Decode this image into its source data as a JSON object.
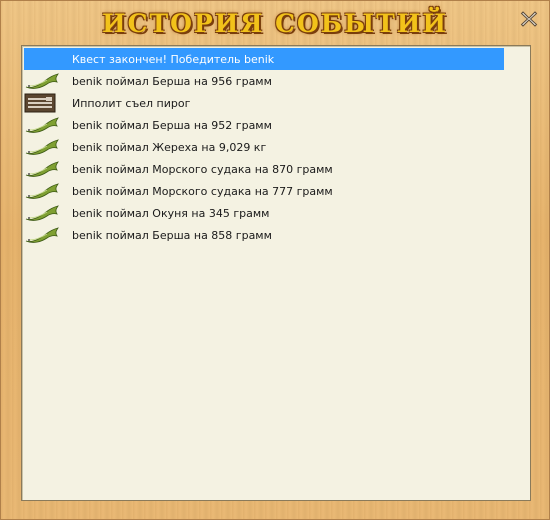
{
  "window": {
    "title": "ИСТОРИЯ СОБЫТИЙ",
    "close_icon": "close-x-icon"
  },
  "events": [
    {
      "icon": "none",
      "text": "Квест закончен! Победитель benik",
      "selected": true
    },
    {
      "icon": "fish-icon",
      "text": "benik поймал Берша на 956 грамм"
    },
    {
      "icon": "food-icon",
      "text": "Ипполит съел пирог"
    },
    {
      "icon": "fish-icon",
      "text": "benik поймал Берша на 952 грамм"
    },
    {
      "icon": "fish-icon",
      "text": "benik поймал Жереха на 9,029 кг"
    },
    {
      "icon": "fish-icon",
      "text": "benik поймал Морского судака на 870 грамм"
    },
    {
      "icon": "fish-icon",
      "text": "benik поймал Морского судака на 777 грамм"
    },
    {
      "icon": "fish-icon",
      "text": "benik поймал Окуня на 345 грамм"
    },
    {
      "icon": "fish-icon",
      "text": "benik поймал Берша на 858 грамм"
    }
  ],
  "colors": {
    "selected_bg": "#3399ff",
    "panel_bg": "#f4f2e2",
    "title_gold": "#f2c21a"
  }
}
